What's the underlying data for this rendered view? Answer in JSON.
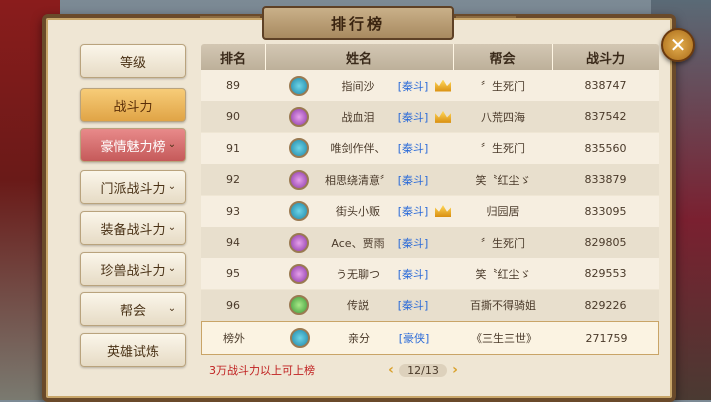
{
  "title": "排行榜",
  "close_icon": "close-icon",
  "tabs": [
    {
      "label": "等级",
      "state": "normal",
      "chevron": false
    },
    {
      "label": "战斗力",
      "state": "active",
      "chevron": false
    },
    {
      "label": "豪情魅力榜",
      "state": "pink",
      "chevron": true
    },
    {
      "label": "门派战斗力",
      "state": "normal",
      "chevron": true
    },
    {
      "label": "装备战斗力",
      "state": "normal",
      "chevron": true
    },
    {
      "label": "珍兽战斗力",
      "state": "normal",
      "chevron": true
    },
    {
      "label": "帮会",
      "state": "normal",
      "chevron": true
    },
    {
      "label": "英雄试炼",
      "state": "normal",
      "chevron": false
    }
  ],
  "table": {
    "headers": {
      "rank": "排名",
      "name": "姓名",
      "guild": "帮会",
      "power": "战斗力"
    },
    "rows": [
      {
        "rank": "89",
        "icon": "blue",
        "name": "指间沙",
        "tag": "[秦斗]",
        "crown": true,
        "guild": "〞生死门",
        "power": "838747"
      },
      {
        "rank": "90",
        "icon": "purple",
        "name": "战血泪",
        "tag": "[秦斗]",
        "crown": true,
        "guild": "八荒四海",
        "power": "837542"
      },
      {
        "rank": "91",
        "icon": "blue",
        "name": "唯剑作伴、",
        "tag": "[秦斗]",
        "crown": false,
        "guild": "〞生死门",
        "power": "835560"
      },
      {
        "rank": "92",
        "icon": "purple",
        "name": "相思绕清意〞",
        "tag": "[秦斗]",
        "crown": false,
        "guild": "笑〝红尘ゞ",
        "power": "833879"
      },
      {
        "rank": "93",
        "icon": "blue",
        "name": "街头小贩",
        "tag": "[秦斗]",
        "crown": true,
        "guild": "归园居",
        "power": "833095"
      },
      {
        "rank": "94",
        "icon": "purple",
        "name": "Ace、贾雨",
        "tag": "[秦斗]",
        "crown": false,
        "guild": "〞生死门",
        "power": "829805"
      },
      {
        "rank": "95",
        "icon": "purple",
        "name": "う无聊つ",
        "tag": "[秦斗]",
        "crown": false,
        "guild": "笑〝红尘ゞ",
        "power": "829553"
      },
      {
        "rank": "96",
        "icon": "green",
        "name": "传説",
        "tag": "[秦斗]",
        "crown": false,
        "guild": "百撕不得骑姐",
        "power": "829226"
      }
    ],
    "self_row": {
      "rank": "榜外",
      "icon": "blue",
      "name": "亲分",
      "tag": "[豪侠]",
      "crown": false,
      "guild": "《三生三世》",
      "power": "271759"
    }
  },
  "footer": {
    "note": "3万战斗力以上可上榜",
    "page": "12/13",
    "prev_icon": "arrow-left-icon",
    "next_icon": "arrow-right-icon"
  }
}
